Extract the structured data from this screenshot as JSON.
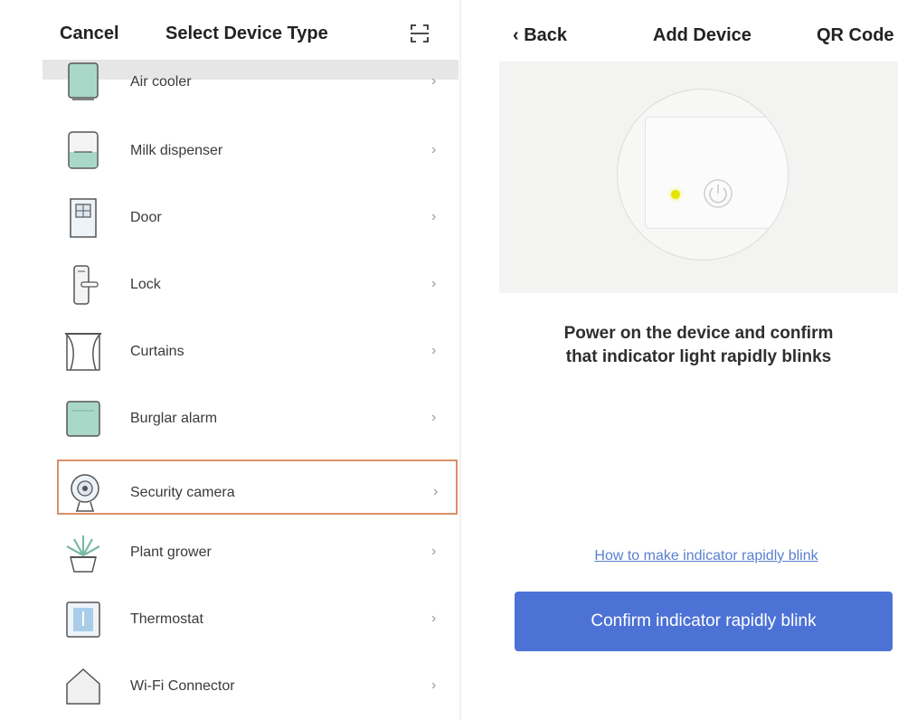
{
  "left_panel": {
    "header": {
      "cancel_label": "Cancel",
      "title": "Select Device Type",
      "scan_icon": "scan-icon"
    },
    "items": [
      {
        "label": "Air cooler",
        "icon": "air-cooler-icon",
        "chevron": "›"
      },
      {
        "label": "Milk dispenser",
        "icon": "milk-dispenser-icon",
        "chevron": "›"
      },
      {
        "label": "Door",
        "icon": "door-icon",
        "chevron": "›"
      },
      {
        "label": "Lock",
        "icon": "lock-icon",
        "chevron": "›"
      },
      {
        "label": "Curtains",
        "icon": "curtains-icon",
        "chevron": "›"
      },
      {
        "label": "Burglar alarm",
        "icon": "burglar-alarm-icon",
        "chevron": "›"
      },
      {
        "label": "Security camera",
        "icon": "security-camera-icon",
        "chevron": "›",
        "selected": true
      },
      {
        "label": "Plant grower",
        "icon": "plant-grower-icon",
        "chevron": "›"
      },
      {
        "label": "Thermostat",
        "icon": "thermostat-icon",
        "chevron": "›"
      },
      {
        "label": "Wi-Fi Connector",
        "icon": "wifi-connector-icon",
        "chevron": "›"
      }
    ]
  },
  "right_panel": {
    "header": {
      "back_label": "Back",
      "title": "Add Device",
      "qr_label": "QR Code"
    },
    "instruction_line1": "Power on the device and confirm",
    "instruction_line2": "that indicator light rapidly blinks",
    "help_link": "How to make indicator rapidly blink",
    "confirm_button": "Confirm indicator rapidly blink"
  },
  "colors": {
    "accent_button": "#4d72d6",
    "link": "#5a7fcf",
    "selected_border": "#d9906a",
    "icon_teal": "#9fd3c2",
    "indicator_led": "#e4e600"
  }
}
